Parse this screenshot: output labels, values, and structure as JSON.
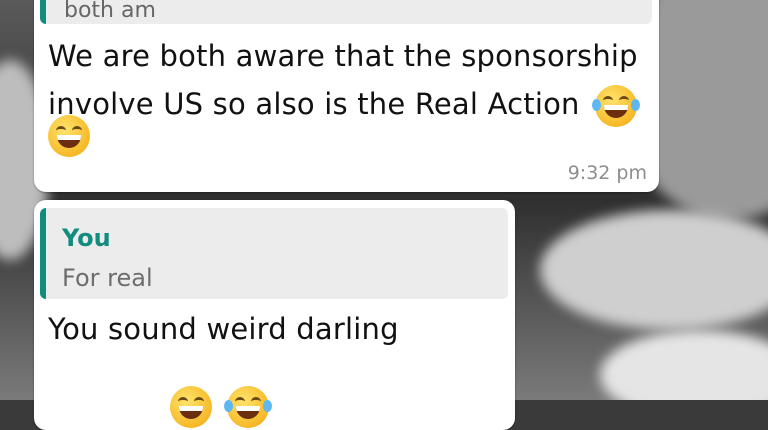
{
  "conversation": {
    "message_1": {
      "quoted_text": "both am",
      "text": "We are both aware that the sponsorship involve US so also is the Real Action",
      "emojis": [
        "face-with-tears-of-joy-icon",
        "grinning-face-icon"
      ],
      "time": "9:32 pm"
    },
    "message_2": {
      "quoted_author": "You",
      "quoted_text": "For real",
      "text": "You sound weird darling",
      "emojis": [
        "grinning-face-icon",
        "face-with-tears-of-joy-icon"
      ]
    }
  },
  "colors": {
    "bubble": "#ffffff",
    "quote_bar": "#128c7e",
    "quote_background": "#ececec",
    "timestamp": "#8d8d8d"
  }
}
